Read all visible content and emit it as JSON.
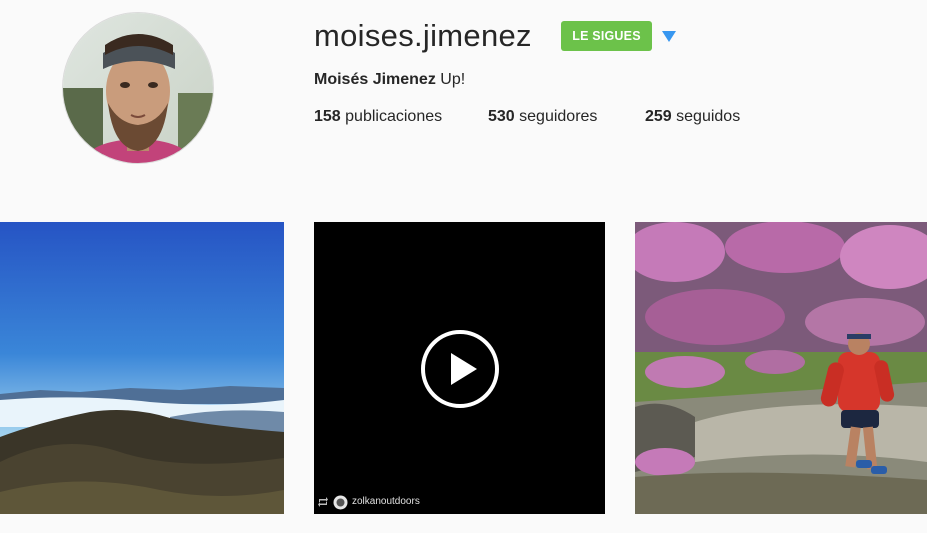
{
  "profile": {
    "username": "moises.jimenez",
    "follow_button_label": "LE SIGUES",
    "full_name": "Moisés Jimenez",
    "bio_text": "Up!",
    "stats": {
      "posts_count": "158",
      "posts_label": "publicaciones",
      "followers_count": "530",
      "followers_label": "seguidores",
      "following_count": "259",
      "following_label": "seguidos"
    }
  },
  "posts": [
    {
      "type": "photo",
      "subject": "mountain-landscape"
    },
    {
      "type": "video",
      "repost_user": "zolkanoutdoors"
    },
    {
      "type": "photo",
      "subject": "trail-runner"
    }
  ],
  "colors": {
    "background": "#fafafa",
    "follow_button": "#6cc24a",
    "dropdown_caret": "#3897f0",
    "text": "#262626"
  }
}
